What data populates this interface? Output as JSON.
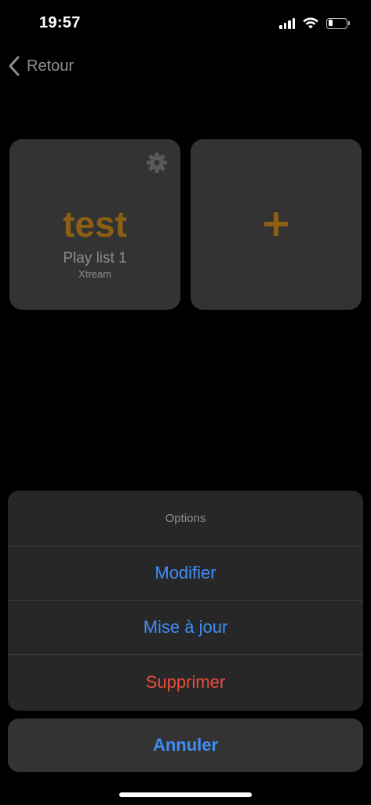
{
  "status_bar": {
    "time": "19:57",
    "battery_level": 0.25
  },
  "nav": {
    "back_label": "Retour"
  },
  "playlist_card": {
    "title": "test",
    "name": "Play list 1",
    "type": "Xtream",
    "settings_icon": "gear-icon"
  },
  "add_card": {
    "icon": "plus-icon"
  },
  "action_sheet": {
    "title": "Options",
    "actions": [
      {
        "label": "Modifier"
      },
      {
        "label": "Mise à jour"
      },
      {
        "label": "Supprimer"
      }
    ],
    "cancel_label": "Annuler"
  },
  "colors": {
    "accent": "#8d5f14",
    "action_blue": "#3e8ef7",
    "destructive_red": "#eb4d3d",
    "card_bg": "#333333",
    "sheet_bg": "#272727"
  }
}
